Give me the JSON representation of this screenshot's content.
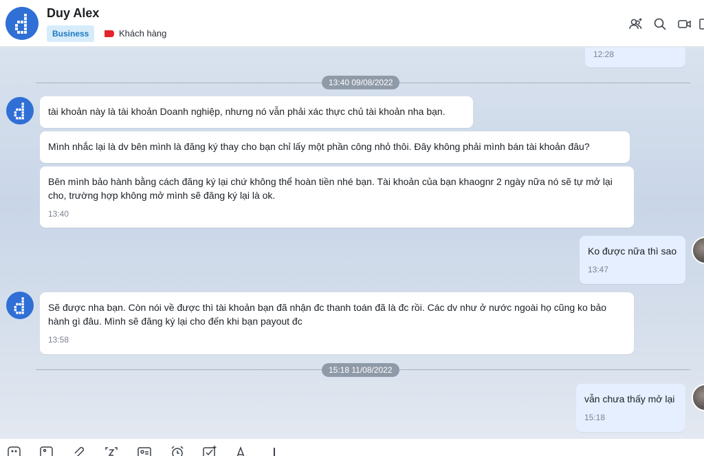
{
  "header": {
    "name": "Duy Alex",
    "badge": "Business",
    "tag": "Khách hàng",
    "icons": [
      "add-member-icon",
      "search-icon",
      "video-call-icon",
      "sidebar-toggle-icon"
    ]
  },
  "chat": {
    "top_partial_time": "12:28",
    "dividers": [
      "13:40 09/08/2022",
      "15:18 11/08/2022"
    ],
    "messages": [
      {
        "sender": "other",
        "text": "tài khoản này là tài khoản Doanh nghiệp, nhưng nó vẫn phải xác thực chủ tài khoản nha bạn."
      },
      {
        "sender": "other",
        "text": "Mình nhắc lại là dv bên mình là đăng ký thay cho bạn chỉ lấy một phần công nhỏ thôi. Đây không phải mình bán tài khoản đâu?"
      },
      {
        "sender": "other",
        "text": "Bên mình bảo hành bằng cách đăng ký lại chứ không thể hoàn tiền nhé bạn. Tài khoản của bạn khaognr 2 ngày nữa nó sẽ tự mở lại cho, trường hợp không mở mình sẽ đăng ký lại là ok.",
        "time": "13:40"
      },
      {
        "sender": "me",
        "text": "Ko được nữa thì sao",
        "time": "13:47"
      },
      {
        "sender": "other",
        "text": "Sẽ được nha bạn. Còn nói về được thì tài khoản bạn đã nhận đc thanh toán đã là đc rồi. Các dv như ở nước ngoài họ cũng ko bảo hành gì đâu. Mình sẽ đăng ký lại cho đến khi bạn payout đc",
        "time": "13:58"
      },
      {
        "sender": "me",
        "text": "vẫn chưa thấy mở lại",
        "time": "15:18"
      }
    ]
  },
  "toolbar": {
    "icons": [
      "sticker-icon",
      "image-icon",
      "attach-icon",
      "screenshot-icon",
      "contact-card-icon",
      "reminder-icon",
      "task-icon",
      "text-format-icon",
      "more-icon"
    ]
  },
  "colors": {
    "brand_blue": "#2f6fd6",
    "badge_bg": "#d6ecfb",
    "badge_text": "#1d77c0",
    "tag_red": "#e3262b",
    "my_bubble": "#e5efff",
    "date_pill": "#8f9aa8"
  }
}
